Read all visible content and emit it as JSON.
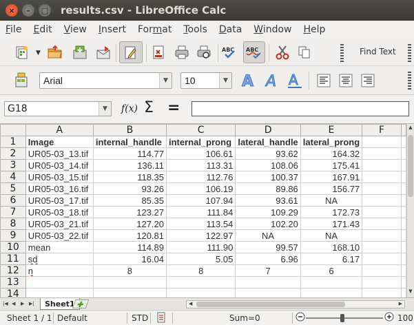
{
  "window": {
    "title": "results.csv - LibreOffice Calc",
    "close_glyph": "×",
    "minimize_glyph": "–",
    "maximize_glyph": "□"
  },
  "menu": [
    {
      "label": "File",
      "u": "F",
      "rest": "ile"
    },
    {
      "label": "Edit",
      "u": "E",
      "rest": "dit"
    },
    {
      "label": "View",
      "u": "V",
      "rest": "iew"
    },
    {
      "label": "Insert",
      "u": "I",
      "rest": "nsert"
    },
    {
      "label": "Format",
      "pre": "For",
      "u": "m",
      "rest": "at"
    },
    {
      "label": "Tools",
      "u": "T",
      "rest": "ools"
    },
    {
      "label": "Data",
      "u": "D",
      "rest": "ata"
    },
    {
      "label": "Window",
      "u": "W",
      "rest": "indow"
    },
    {
      "label": "Help",
      "u": "H",
      "rest": "elp"
    }
  ],
  "toolbar": {
    "find_text_label": "Find Text",
    "font_name": "Arial",
    "font_size": "10",
    "accent": "#3a78c8"
  },
  "formula_bar": {
    "name_box": "G18",
    "fx_label": "f(x)",
    "sum_glyph": "Σ",
    "equals_glyph": "=",
    "content": ""
  },
  "sheet": {
    "columns": [
      "A",
      "B",
      "C",
      "D",
      "E",
      "F"
    ],
    "rows": [
      [
        "Image",
        "internal_handle",
        "internal_prong",
        "lateral_handle",
        "lateral_prong",
        ""
      ],
      [
        "UR05-03_13.tif",
        "114.77",
        "106.61",
        "93.62",
        "164.32",
        ""
      ],
      [
        "UR05-03_14.tif",
        "136.11",
        "113.31",
        "108.06",
        "175.41",
        ""
      ],
      [
        "UR05-03_15.tif",
        "118.35",
        "112.76",
        "100.37",
        "167.91",
        ""
      ],
      [
        "UR05-03_16.tif",
        "93.26",
        "106.19",
        "89.86",
        "156.77",
        ""
      ],
      [
        "UR05-03_17.tif",
        "85.35",
        "107.94",
        "93.61",
        "NA",
        ""
      ],
      [
        "UR05-03_18.tif",
        "123.27",
        "111.84",
        "109.29",
        "172.73",
        ""
      ],
      [
        "UR05-03_21.tif",
        "127.20",
        "113.54",
        "102.20",
        "171.43",
        ""
      ],
      [
        "UR05-03_22.tif",
        "120.81",
        "122.97",
        "NA",
        "NA",
        ""
      ],
      [
        "mean",
        "114.89",
        "111.90",
        "99.57",
        "168.10",
        ""
      ],
      [
        "sd",
        "16.04",
        "5.05",
        "6.96",
        "6.17",
        ""
      ],
      [
        "n",
        "8",
        "8",
        "7",
        "6",
        ""
      ],
      [
        "",
        "",
        "",
        "",
        "",
        ""
      ],
      [
        "",
        "",
        "",
        "",
        "",
        ""
      ]
    ]
  },
  "tabs": {
    "active_sheet": "Sheet1"
  },
  "status": {
    "sheet_position": "Sheet 1 / 1",
    "page_style": "Default",
    "selection_mode": "STD",
    "sum": "Sum=0",
    "zoom": "100"
  }
}
